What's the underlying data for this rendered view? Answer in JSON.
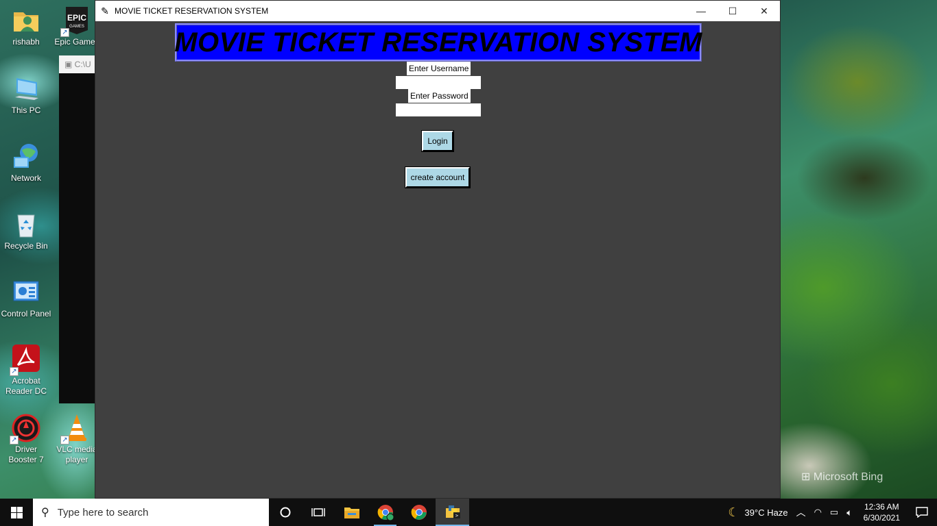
{
  "desktop": {
    "icons": [
      {
        "label": "rishabh"
      },
      {
        "label": "Epic Games"
      },
      {
        "label": "This PC"
      },
      {
        "label": "Network"
      },
      {
        "label": "Recycle Bin"
      },
      {
        "label": "Control Panel"
      },
      {
        "label": "Acrobat Reader DC"
      },
      {
        "label": "Driver Booster 7"
      },
      {
        "label": "VLC media player"
      }
    ],
    "console_title": "C:\\U",
    "watermark": "Microsoft Bing"
  },
  "window": {
    "title": "MOVIE TICKET RESERVATION SYSTEM",
    "minimize": "—",
    "maximize": "☐",
    "close": "✕"
  },
  "app": {
    "banner": "MOVIE TICKET RESERVATION SYSTEM",
    "username_label": "Enter Username",
    "username_value": "",
    "password_label": "Enter Password",
    "password_value": "",
    "login_button": "Login",
    "create_account_button": "create account",
    "colors": {
      "background": "#404040",
      "banner_bg": "#0000ff",
      "button_bg": "#add8e6"
    }
  },
  "taskbar": {
    "search_placeholder": "Type here to search",
    "weather": "39°C  Haze",
    "time": "12:36 AM",
    "date": "6/30/2021"
  }
}
